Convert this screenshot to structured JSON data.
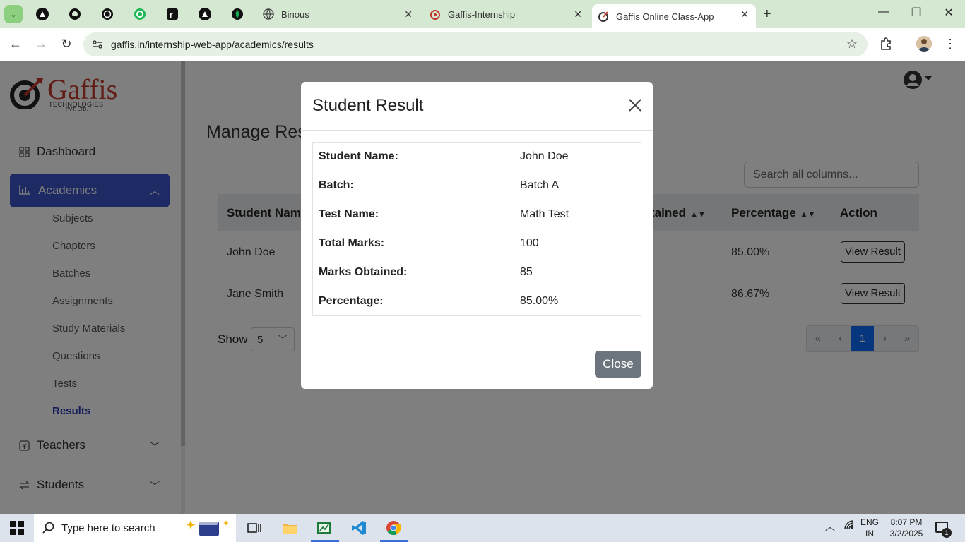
{
  "browser": {
    "tabs": [
      {
        "title": "Binous",
        "active": false
      },
      {
        "title": "Gaffis-Internship",
        "active": false
      },
      {
        "title": "Gaffis Online Class-App",
        "active": true
      }
    ],
    "url": "gaffis.in/internship-web-app/academics/results",
    "accent": "#d5e8d2"
  },
  "sidebar": {
    "logo_text": "Gaffis",
    "logo_sub": "TECHNOLOGIES",
    "logo_sub2": "PVT. LTD.",
    "dashboard_label": "Dashboard",
    "academics_label": "Academics",
    "sub_items": [
      "Subjects",
      "Chapters",
      "Batches",
      "Assignments",
      "Study Materials",
      "Questions",
      "Tests",
      "Results"
    ],
    "teachers_label": "Teachers",
    "students_label": "Students",
    "active_color": "#3a55c9"
  },
  "main": {
    "title": "Manage Resu",
    "search_placeholder": "Search all columns...",
    "columns": {
      "student_name": "Student Name",
      "obtained": "tained",
      "percentage": "Percentage",
      "action": "Action"
    },
    "rows": [
      {
        "name": "John Doe",
        "percentage": "85.00%",
        "action": "View Result"
      },
      {
        "name": "Jane Smith",
        "percentage": "86.67%",
        "action": "View Result"
      }
    ],
    "show_label": "Show",
    "show_value": "5",
    "pager": {
      "first": "«",
      "prev": "‹",
      "current": "1",
      "next": "›",
      "last": "»"
    }
  },
  "modal": {
    "title": "Student Result",
    "rows": [
      {
        "label": "Student Name:",
        "value": "John Doe"
      },
      {
        "label": "Batch:",
        "value": "Batch A"
      },
      {
        "label": "Test Name:",
        "value": "Math Test"
      },
      {
        "label": "Total Marks:",
        "value": "100"
      },
      {
        "label": "Marks Obtained:",
        "value": "85"
      },
      {
        "label": "Percentage:",
        "value": "85.00%"
      }
    ],
    "close_label": "Close"
  },
  "taskbar": {
    "search_placeholder": "Type here to search",
    "lang_top": "ENG",
    "lang_bottom": "IN",
    "time": "8:07 PM",
    "date": "3/2/2025",
    "notification_count": "1"
  }
}
